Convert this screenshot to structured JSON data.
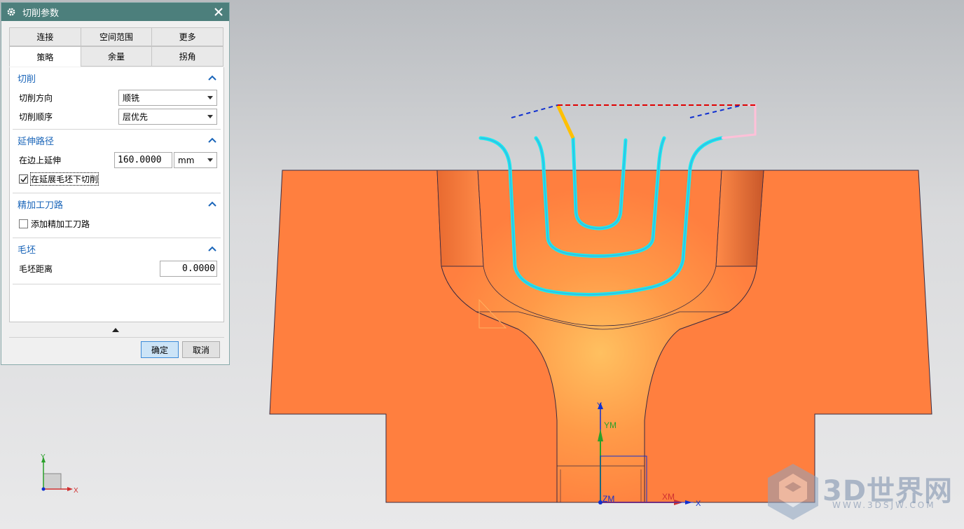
{
  "dialog": {
    "title": "切削参数",
    "tabs_row1": [
      "连接",
      "空间范围",
      "更多"
    ],
    "tabs_row2": [
      "策略",
      "余量",
      "拐角"
    ],
    "active_tab": "策略",
    "groups": {
      "cut": {
        "title": "切削",
        "direction_label": "切削方向",
        "direction_value": "顺铣",
        "order_label": "切削顺序",
        "order_value": "层优先"
      },
      "extend": {
        "title": "延伸路径",
        "edge_label": "在边上延伸",
        "edge_value": "160.0000",
        "edge_unit": "mm",
        "under_blank_label": "在延展毛坯下切削",
        "under_blank_checked": true
      },
      "finish": {
        "title": "精加工刀路",
        "add_label": "添加精加工刀路",
        "add_checked": false
      },
      "blank": {
        "title": "毛坯",
        "distance_label": "毛坯距离",
        "distance_value": "0.0000"
      }
    },
    "ok_label": "确定",
    "cancel_label": "取消"
  },
  "viewport": {
    "triad": {
      "x": "X",
      "y": "Y"
    },
    "wcs": {
      "ym": "YM",
      "xm": "XM",
      "zm": "ZM",
      "y": "Y",
      "x": "X"
    },
    "part_color": "#ff7f3f",
    "toolpath_color": "#19eaf0"
  },
  "watermark": {
    "brand": "3D世界网",
    "url": "WWW.3DSJW.COM"
  }
}
